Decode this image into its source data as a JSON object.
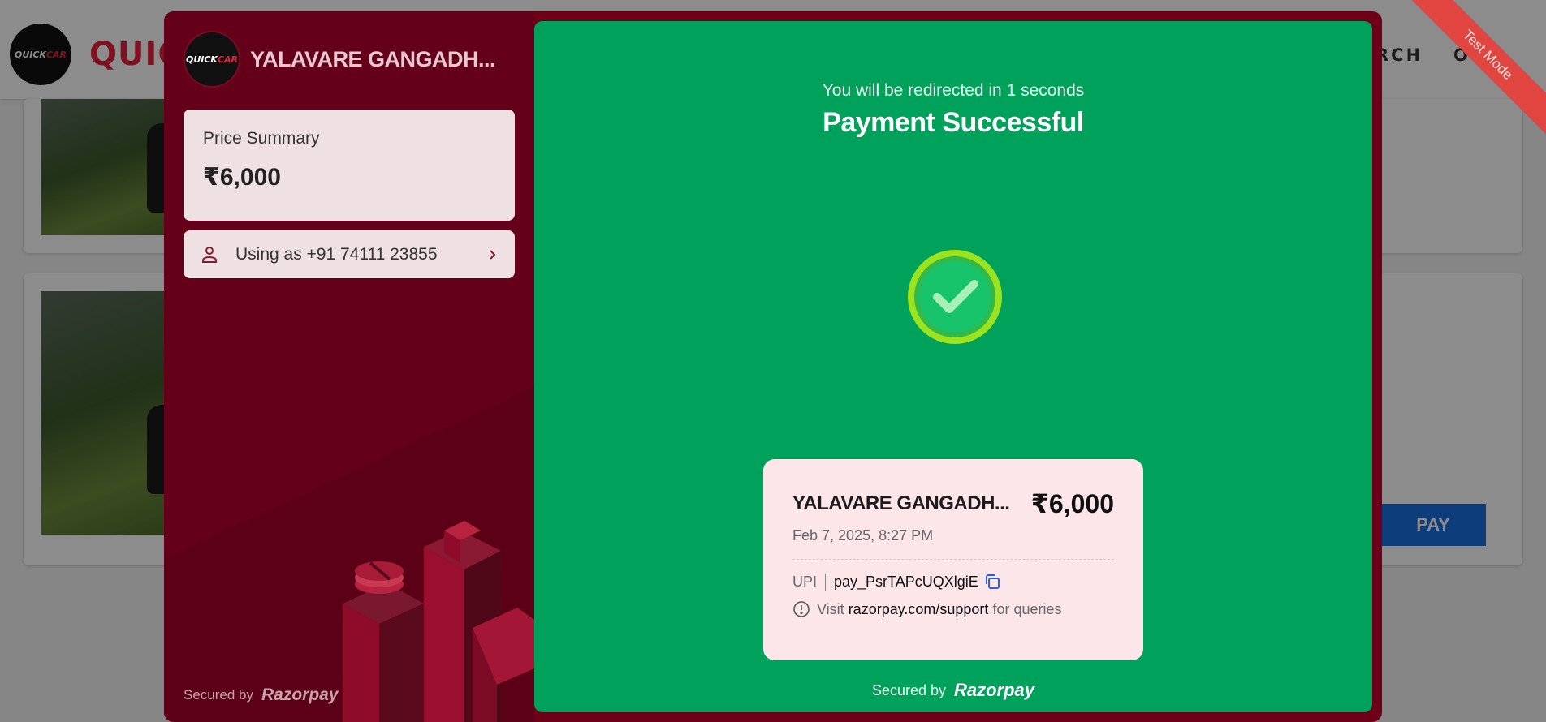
{
  "background": {
    "brand": "QUICKCAR",
    "brand_visible": "QUIC",
    "logo_text_a": "QUICK",
    "logo_text_b": "CAR",
    "nav_search": "RCH",
    "nav_logout": "OUT",
    "pay_button": "PAY"
  },
  "modal": {
    "merchant": {
      "name": "YALAVARE GANGADH...",
      "logo_text_a": "QUICK",
      "logo_text_b": "CAR"
    },
    "price_summary": {
      "label": "Price Summary",
      "amount": "₹6,000"
    },
    "user": {
      "label": "Using as +91 74111 23855"
    },
    "left_footer": {
      "secured_by": "Secured by",
      "brand": "Razorpay"
    },
    "status": {
      "redirect": "You will be redirected in 1 seconds",
      "title": "Payment Successful"
    },
    "receipt": {
      "merchant": "YALAVARE GANGADH...",
      "amount": "₹6,000",
      "datetime": "Feb 7, 2025, 8:27 PM",
      "method": "UPI",
      "payment_id": "pay_PsrTAPcUQXlgiE",
      "help_prefix": "Visit",
      "help_link": "razorpay.com/support",
      "help_suffix": "for queries"
    },
    "right_footer": {
      "secured_by": "Secured by",
      "brand": "Razorpay"
    },
    "ribbon": "Test Mode"
  },
  "colors": {
    "left_panel": "#64001a",
    "right_panel": "#00a15a",
    "success_check": "#8ee51f",
    "ribbon": "#e0453f"
  },
  "icons": [
    "user-icon",
    "chevron-right-icon",
    "check-circle-icon",
    "copy-icon",
    "info-icon",
    "razorpay-logo-icon"
  ]
}
